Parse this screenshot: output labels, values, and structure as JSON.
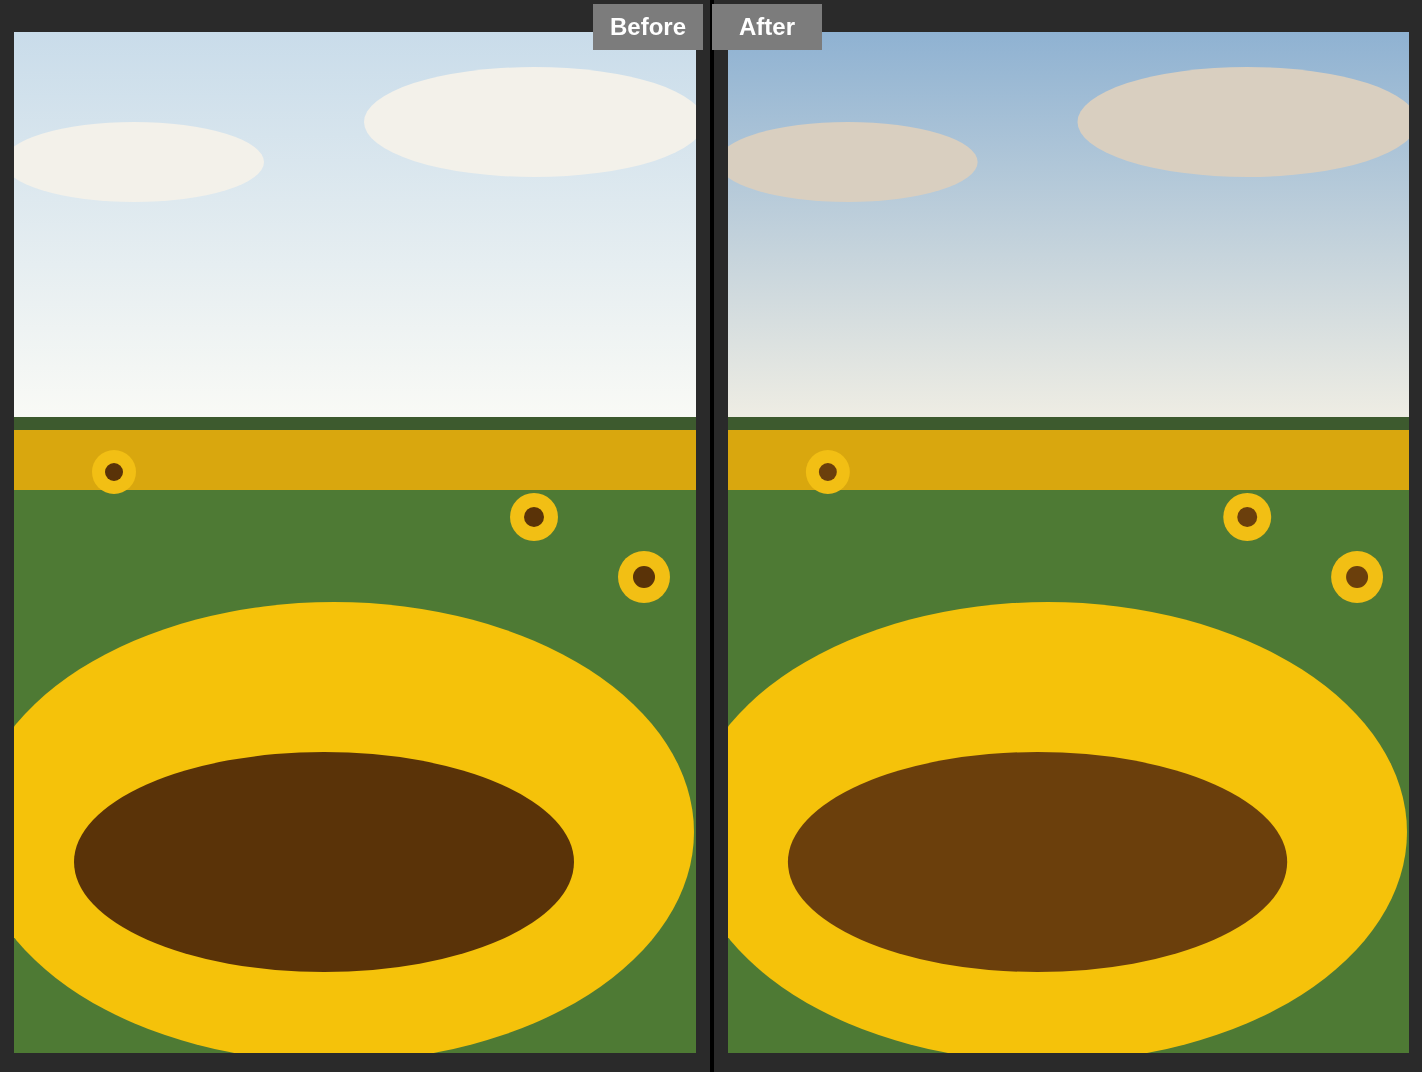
{
  "panels": [
    {
      "label": "Before"
    },
    {
      "label": "After"
    }
  ]
}
